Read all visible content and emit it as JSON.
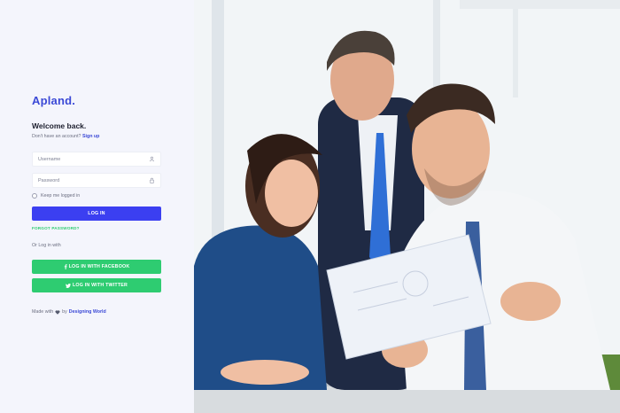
{
  "brand": {
    "logo": "Apland."
  },
  "login": {
    "heading": "Welcome back.",
    "signup_prompt": "Don't have an account?",
    "signup_link": "Sign up",
    "username_placeholder": "Username",
    "password_placeholder": "Password",
    "remember_label": "Keep me logged in",
    "login_button": "LOG IN",
    "forgot_link": "FORGOT PASSWORD?",
    "or_text": "Or Log in with",
    "facebook_button": "LOG IN WITH FACEBOOK",
    "twitter_button": "LOG IN WITH TWITTER"
  },
  "footer": {
    "made_with": "Made with",
    "by": "by",
    "author": "Designing World"
  },
  "colors": {
    "accent": "#3b3ff1",
    "brand_text": "#3b49d6",
    "social": "#2ecc71",
    "panel_bg": "#f4f5fc"
  },
  "icons": {
    "username": "user-icon",
    "password": "lock-icon",
    "facebook": "facebook-icon",
    "twitter": "twitter-icon",
    "heart": "heart-icon"
  },
  "photo": {
    "subject": "three business people looking at a document"
  }
}
